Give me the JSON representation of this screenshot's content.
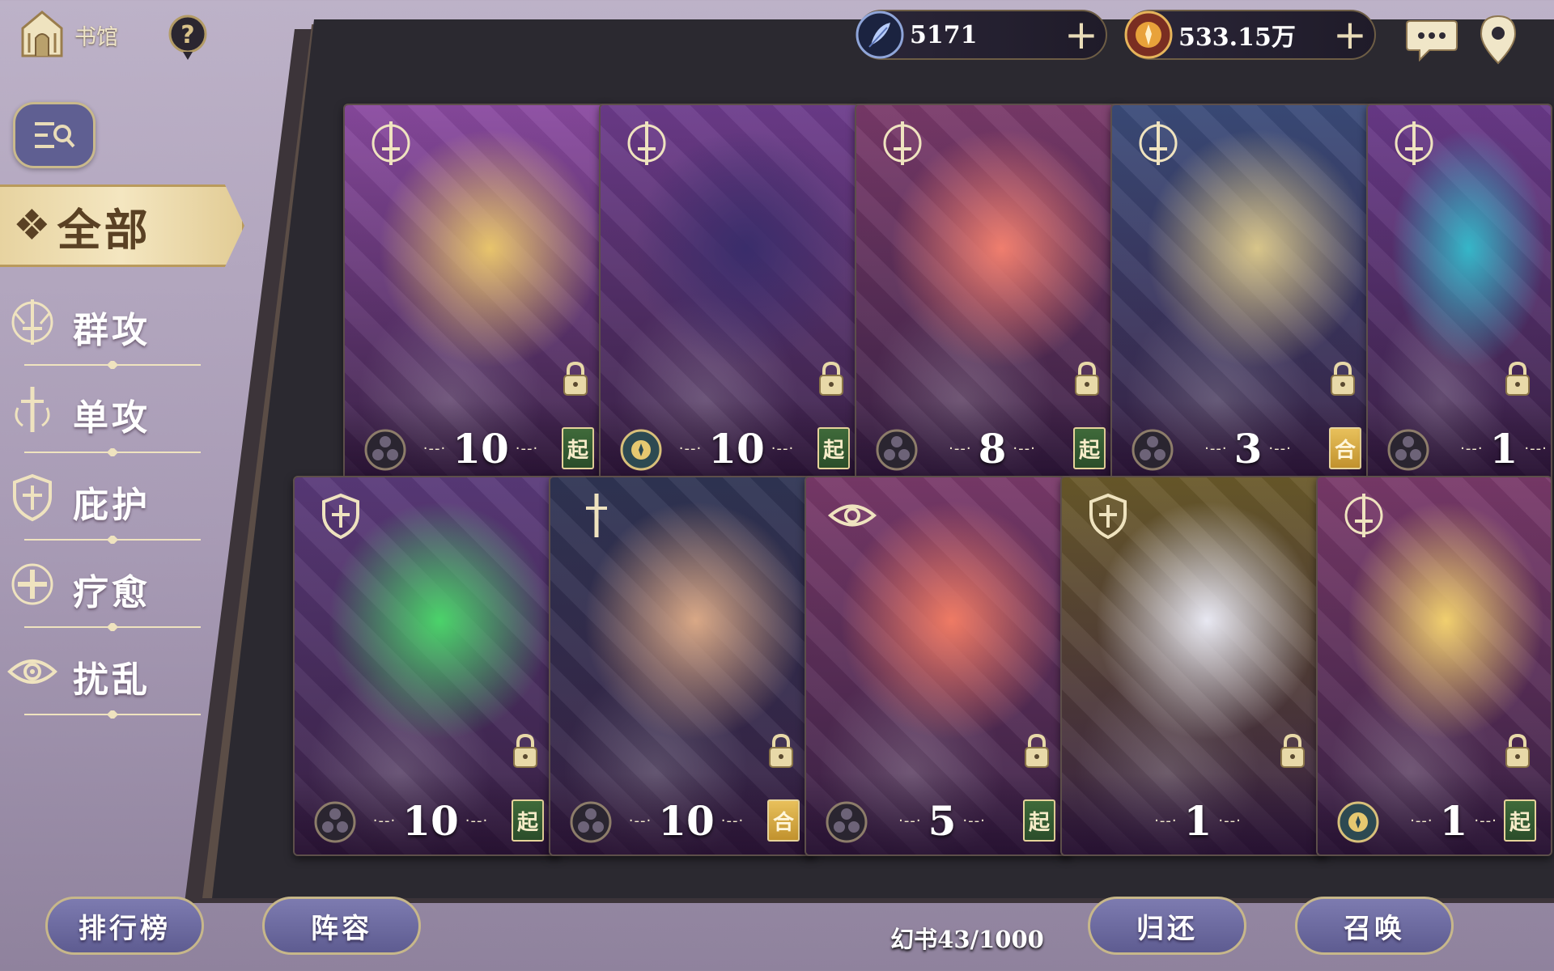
{
  "header": {
    "home_label": "书馆",
    "currencies": [
      {
        "icon": "crystal-feather-icon",
        "value": "5171"
      },
      {
        "icon": "gold-coin-icon",
        "value": "533.15万"
      }
    ]
  },
  "filters": {
    "all_label": "全部",
    "items": [
      {
        "key": "aoe",
        "label": "群攻"
      },
      {
        "key": "single",
        "label": "单攻"
      },
      {
        "key": "shield",
        "label": "庇护"
      },
      {
        "key": "heal",
        "label": "疗愈"
      },
      {
        "key": "disrupt",
        "label": "扰乱"
      }
    ]
  },
  "cards": [
    {
      "stars": "10",
      "rank": "起",
      "rank_color": "green",
      "class_icon": "sword-emblem-icon",
      "faction_icon": "tri-orb-icon",
      "palette": [
        "#8a4aa0",
        "#e8c46c"
      ]
    },
    {
      "stars": "10",
      "rank": "起",
      "rank_color": "green",
      "class_icon": "sword-emblem-icon",
      "faction_icon": "medal-emblem-icon",
      "palette": [
        "#6d3c8c",
        "#3a2d6b"
      ]
    },
    {
      "stars": "8",
      "rank": "起",
      "rank_color": "green",
      "class_icon": "sword-emblem-icon",
      "faction_icon": "tri-orb-icon",
      "palette": [
        "#7a3a6a",
        "#f07e6e"
      ]
    },
    {
      "stars": "3",
      "rank": "合",
      "rank_color": "gold",
      "class_icon": "sword-emblem-icon",
      "faction_icon": "tri-orb-icon",
      "palette": [
        "#3b4c7a",
        "#d8c58a"
      ]
    },
    {
      "stars": "1",
      "rank": "",
      "rank_color": "gold",
      "class_icon": "sword-emblem-icon",
      "faction_icon": "tri-orb-icon",
      "palette": [
        "#6a3a8a",
        "#35b6c8"
      ]
    },
    {
      "stars": "10",
      "rank": "起",
      "rank_color": "green",
      "class_icon": "shield-emblem-icon",
      "faction_icon": "tri-orb-icon",
      "palette": [
        "#5a3a7a",
        "#4bd36a"
      ]
    },
    {
      "stars": "10",
      "rank": "合",
      "rank_color": "gold",
      "class_icon": "dagger-emblem-icon",
      "faction_icon": "tri-orb-icon",
      "palette": [
        "#2f3554",
        "#d9a886"
      ]
    },
    {
      "stars": "5",
      "rank": "起",
      "rank_color": "green",
      "class_icon": "eye-emblem-icon",
      "faction_icon": "tri-orb-icon",
      "palette": [
        "#7a3a6a",
        "#ef7a64"
      ]
    },
    {
      "stars": "1",
      "rank": "",
      "rank_color": "gold",
      "class_icon": "shield-emblem-icon",
      "faction_icon": "",
      "palette": [
        "#6a5a2a",
        "#e8e8f2"
      ]
    },
    {
      "stars": "1",
      "rank": "起",
      "rank_color": "green",
      "class_icon": "sword-emblem-icon",
      "faction_icon": "medal-emblem-icon",
      "palette": [
        "#7a3a6a",
        "#f1cf6e"
      ]
    }
  ],
  "footer": {
    "ranking_label": "排行榜",
    "lineup_label": "阵容",
    "book_count": "幻书43/1000",
    "return_label": "归还",
    "summon_label": "召唤"
  }
}
